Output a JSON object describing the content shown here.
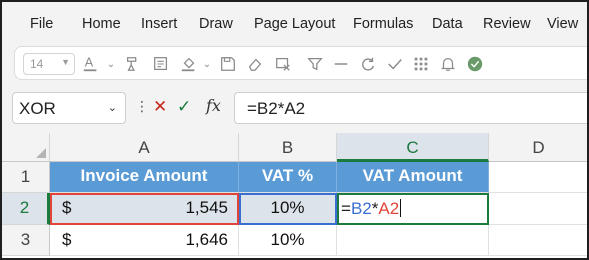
{
  "menu": [
    "File",
    "Home",
    "Insert",
    "Draw",
    "Page Layout",
    "Formulas",
    "Data",
    "Review",
    "View"
  ],
  "toolbar": {
    "font_size": "14",
    "icons": [
      "font-color-icon",
      "format-painter-icon",
      "format-icon",
      "fill-color-icon",
      "save-as-icon",
      "eraser-icon",
      "clear-formats-icon",
      "filter-icon",
      "minus-icon",
      "refresh-icon",
      "checkmark-icon",
      "grid-icon",
      "bell-icon",
      "check-circle-icon"
    ]
  },
  "formula_bar": {
    "name_box": "XOR",
    "cancel_symbol": "✕",
    "enter_symbol": "✓",
    "fx_label": "fx",
    "formula": "=B2*A2"
  },
  "sheet": {
    "columns": [
      "A",
      "B",
      "C",
      "D"
    ],
    "rows": [
      "1",
      "2",
      "3"
    ],
    "selected_column": "C",
    "selected_row": "2",
    "header": {
      "a": "Invoice Amount",
      "b": "VAT %",
      "c": "VAT Amount"
    },
    "row2": {
      "a_currency": "$",
      "a_value": "1,545",
      "b": "10%"
    },
    "row3": {
      "a_currency": "$",
      "a_value": "1,646",
      "b": "10%"
    },
    "edit_cell": {
      "eq": "=",
      "ref1": "B2",
      "op": "*",
      "ref2": "A2"
    },
    "colors": {
      "header_fill": "#5b9bd5",
      "active_green": "#1b7a3e",
      "ref_red": "#e0443a",
      "ref_blue": "#3a6fd1"
    }
  }
}
